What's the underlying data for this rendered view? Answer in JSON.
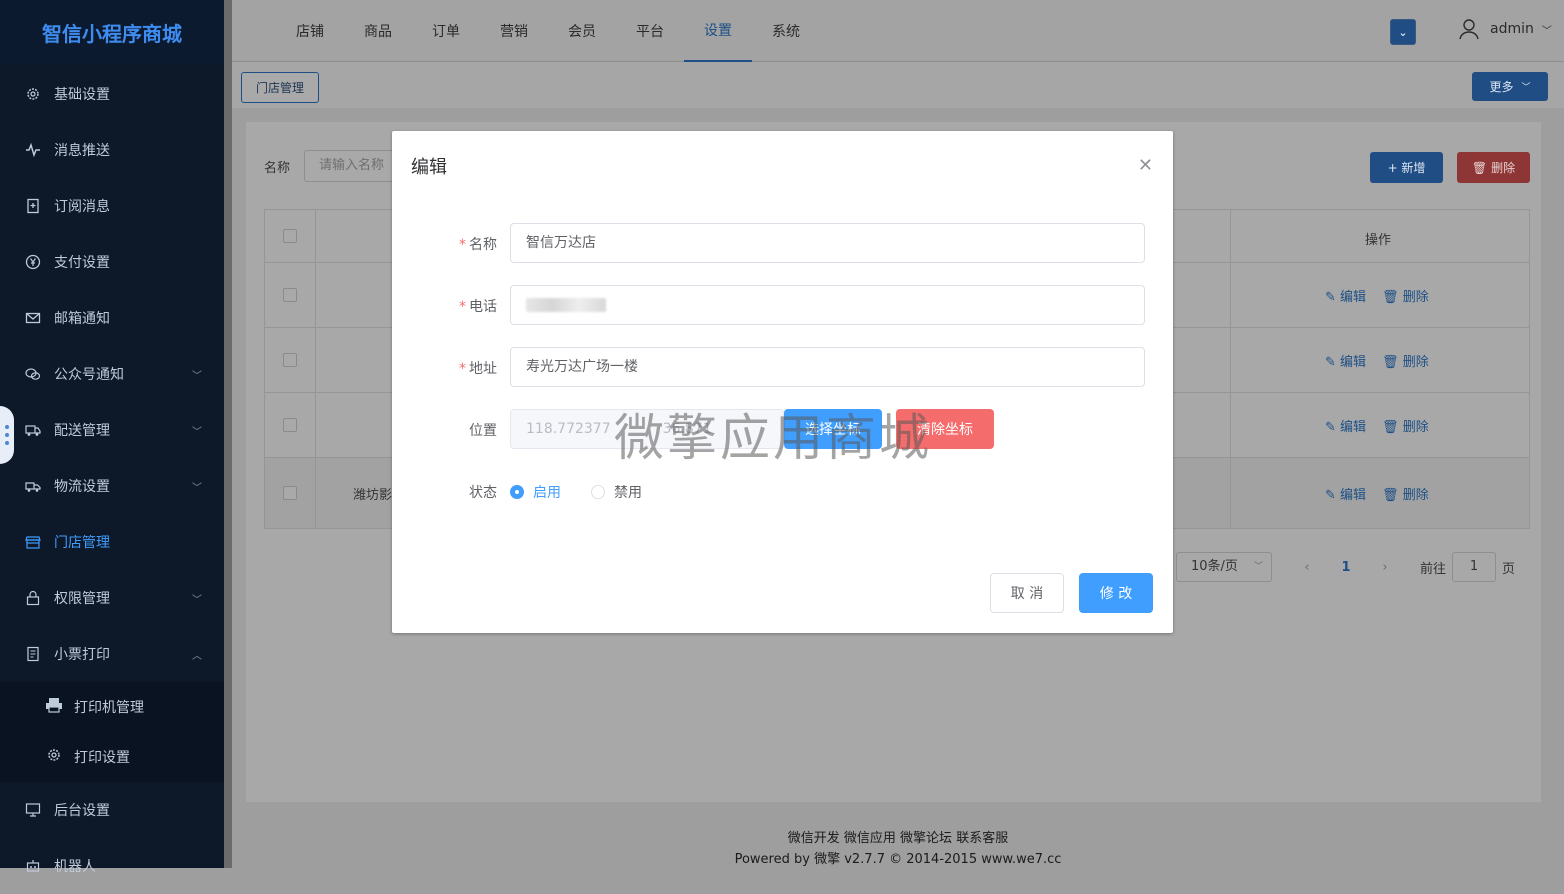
{
  "sidebar": {
    "brand": "智信小程序商城",
    "items": [
      {
        "label": "基础设置",
        "icon": "gear-icon"
      },
      {
        "label": "消息推送",
        "icon": "pulse-icon"
      },
      {
        "label": "订阅消息",
        "icon": "bookmark-icon"
      },
      {
        "label": "支付设置",
        "icon": "yen-icon"
      },
      {
        "label": "邮箱通知",
        "icon": "mail-icon"
      },
      {
        "label": "公众号通知",
        "icon": "wechat-icon"
      },
      {
        "label": "配送管理",
        "icon": "truck-icon"
      },
      {
        "label": "物流设置",
        "icon": "delivery-icon"
      },
      {
        "label": "门店管理",
        "icon": "store-icon"
      },
      {
        "label": "权限管理",
        "icon": "lock-icon"
      },
      {
        "label": "小票打印",
        "icon": "receipt-icon"
      }
    ],
    "subitems": [
      {
        "label": "打印机管理",
        "icon": "printer-icon"
      },
      {
        "label": "打印设置",
        "icon": "gear-icon"
      }
    ],
    "bottom_items": [
      {
        "label": "后台设置",
        "icon": "monitor-icon"
      },
      {
        "label": "机器人",
        "icon": "robot-icon"
      }
    ]
  },
  "topnav": {
    "tabs": [
      "店铺",
      "商品",
      "订单",
      "营销",
      "会员",
      "平台",
      "设置",
      "系统"
    ],
    "active": "设置",
    "username": "admin"
  },
  "subbar": {
    "store_tab": "门店管理",
    "more_label": "更多"
  },
  "list": {
    "filter_label": "名称",
    "filter_placeholder": "请输入名称",
    "add_label": "+ 新增",
    "delete_label": "删除",
    "ops_header": "操作",
    "edit_label": "编辑",
    "row_delete_label": "删除",
    "partial_name": "潍坊影",
    "pager": {
      "page_size": "10条/页",
      "current_page": "1",
      "goto_label": "前往",
      "goto_value": "1",
      "page_suffix": "页"
    }
  },
  "modal": {
    "title": "编辑",
    "fields": {
      "name_label": "名称",
      "name_value": "智信万达店",
      "phone_label": "电话",
      "address_label": "地址",
      "address_value": "寿光万达广场一楼",
      "location_label": "位置",
      "longitude": "118.772377",
      "latitude": "36.871",
      "pick_label": "选择坐标",
      "clear_label": "清除坐标",
      "status_label": "状态",
      "status_on": "启用",
      "status_off": "禁用"
    },
    "cancel_label": "取 消",
    "submit_label": "修 改"
  },
  "watermark": "微擎应用商城",
  "footer": {
    "links": "微信开发 微信应用 微擎论坛 联系客服",
    "powered": "Powered by 微擎 v2.7.7 © 2014-2015 www.we7.cc"
  },
  "colors": {
    "primary": "#409eff",
    "danger": "#f56c6c",
    "sidebar_bg": "#0d1829"
  }
}
